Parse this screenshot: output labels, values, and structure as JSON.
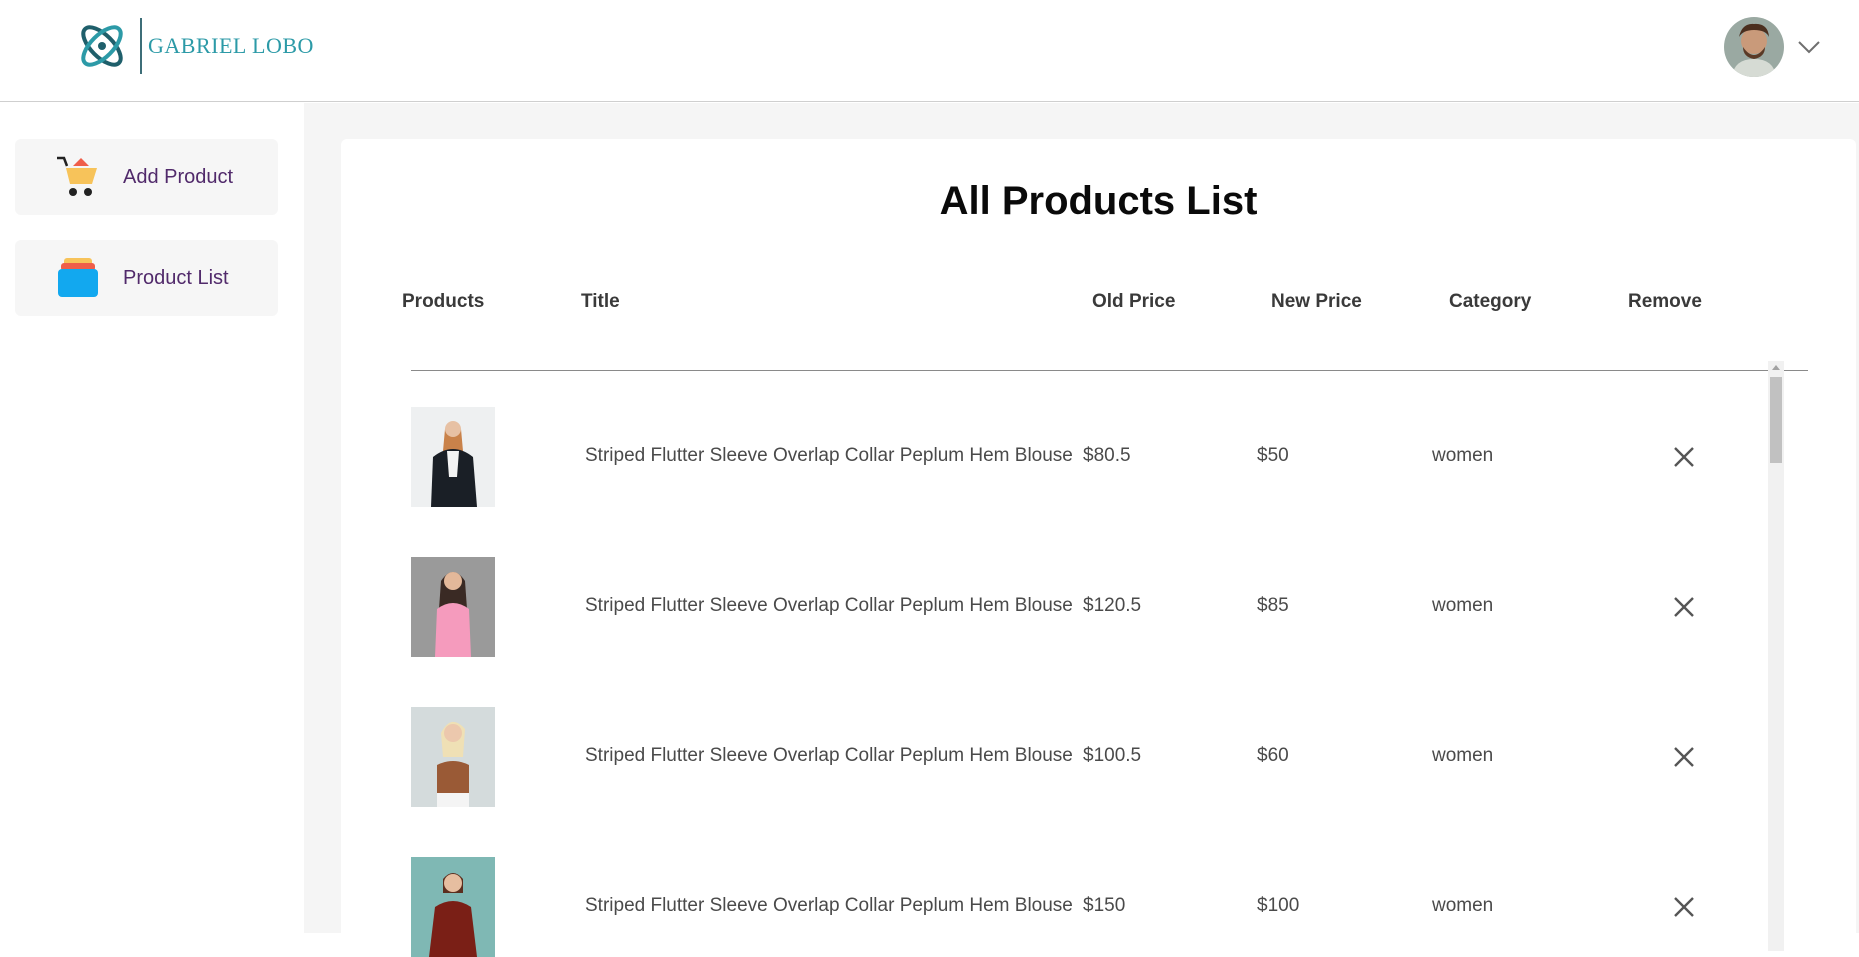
{
  "brand": {
    "name": "GABRIEL LOBO"
  },
  "header": {
    "avatar_icon": "user-avatar",
    "menu_icon": "chevron-down-icon"
  },
  "sidebar": {
    "items": [
      {
        "label": "Add Product",
        "icon": "cart-icon"
      },
      {
        "label": "Product List",
        "icon": "list-stack-icon"
      }
    ]
  },
  "main": {
    "title": "All Products List",
    "columns": [
      "Products",
      "Title",
      "Old Price",
      "New Price",
      "Category",
      "Remove"
    ],
    "rows": [
      {
        "title": "Striped Flutter Sleeve Overlap Collar Peplum Hem Blouse",
        "old_price": "$80.5",
        "new_price": "$50",
        "category": "women"
      },
      {
        "title": "Striped Flutter Sleeve Overlap Collar Peplum Hem Blouse",
        "old_price": "$120.5",
        "new_price": "$85",
        "category": "women"
      },
      {
        "title": "Striped Flutter Sleeve Overlap Collar Peplum Hem Blouse",
        "old_price": "$100.5",
        "new_price": "$60",
        "category": "women"
      },
      {
        "title": "Striped Flutter Sleeve Overlap Collar Peplum Hem Blouse",
        "old_price": "$150",
        "new_price": "$100",
        "category": "women"
      }
    ]
  },
  "colors": {
    "sidebar_label": "#512a6b",
    "logo_teal": "#2c9aa7",
    "panel_bg": "#f5f5f5"
  }
}
